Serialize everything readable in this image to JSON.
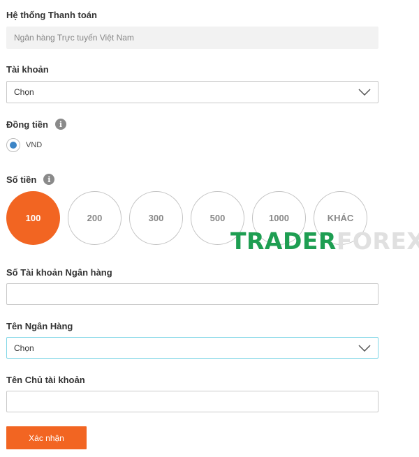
{
  "payment_system": {
    "label": "Hệ thống Thanh toán",
    "value": "Ngân hàng Trực tuyến Việt Nam"
  },
  "account": {
    "label": "Tài khoản",
    "selected": "Chọn"
  },
  "currency": {
    "label": "Đồng tiền",
    "option": "VND"
  },
  "amount": {
    "label": "Số tiền",
    "options": [
      "100",
      "200",
      "300",
      "500",
      "1000",
      "KHÁC"
    ],
    "selected": "100"
  },
  "bank_account_number": {
    "label": "Số Tài khoản Ngân hàng",
    "value": ""
  },
  "bank_name": {
    "label": "Tên Ngân Hàng",
    "selected": "Chọn"
  },
  "account_holder": {
    "label": "Tên Chủ tài khoản",
    "value": ""
  },
  "submit_label": "Xác nhận",
  "watermark": {
    "part1": "TRADER",
    "part2": "FOREX"
  },
  "colors": {
    "accent": "#f26522",
    "radio": "#3d85c6",
    "watermark": "#1e9e52"
  }
}
